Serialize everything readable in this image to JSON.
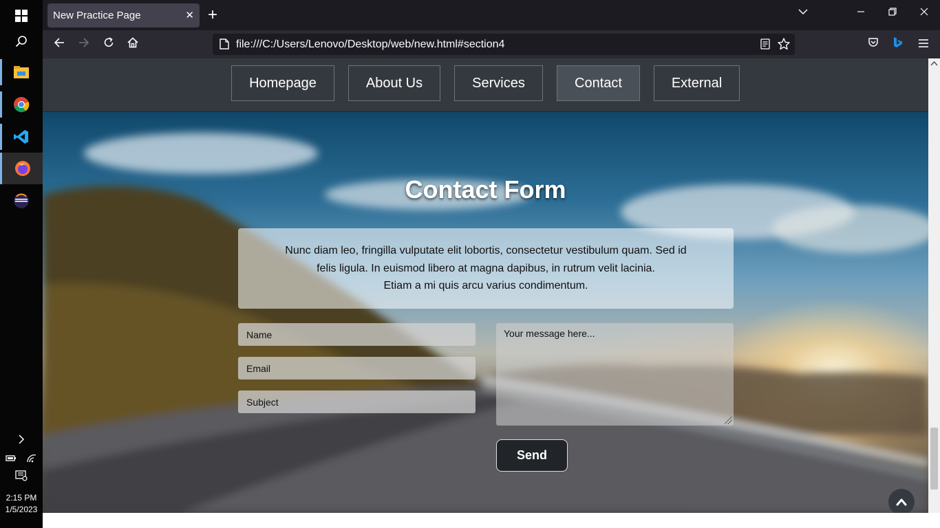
{
  "taskbar": {
    "time": "2:15 PM",
    "date": "1/5/2023",
    "icons": [
      "windows-start-icon",
      "search-icon",
      "file-explorer-icon",
      "chrome-icon",
      "vscode-icon",
      "firefox-icon",
      "eclipse-icon"
    ]
  },
  "browser": {
    "tab_title": "New Practice Page",
    "tab_close": "✕",
    "new_tab": "+",
    "url": "file:///C:/Users/Lenovo/Desktop/web/new.html#section4"
  },
  "site": {
    "nav": [
      {
        "label": "Homepage"
      },
      {
        "label": "About Us"
      },
      {
        "label": "Services"
      },
      {
        "label": "Contact",
        "active": true
      },
      {
        "label": "External"
      }
    ],
    "form_title": "Contact Form",
    "intro_lines": [
      "Nunc diam leo, fringilla vulputate elit lobortis, consectetur vestibulum quam. Sed id",
      "felis ligula. In euismod libero at magna dapibus, in rutrum velit lacinia.",
      "Etiam a mi quis arcu varius condimentum."
    ],
    "fields": {
      "name_placeholder": "Name",
      "email_placeholder": "Email",
      "subject_placeholder": "Subject",
      "message_placeholder": "Your message here..."
    },
    "send_label": "Send"
  },
  "colors": {
    "taskbar": "#060606",
    "tab_strip": "#1c1b22",
    "nav_bar": "#2b2a33",
    "site_nav": "#34393f",
    "send_button": "#212529"
  }
}
